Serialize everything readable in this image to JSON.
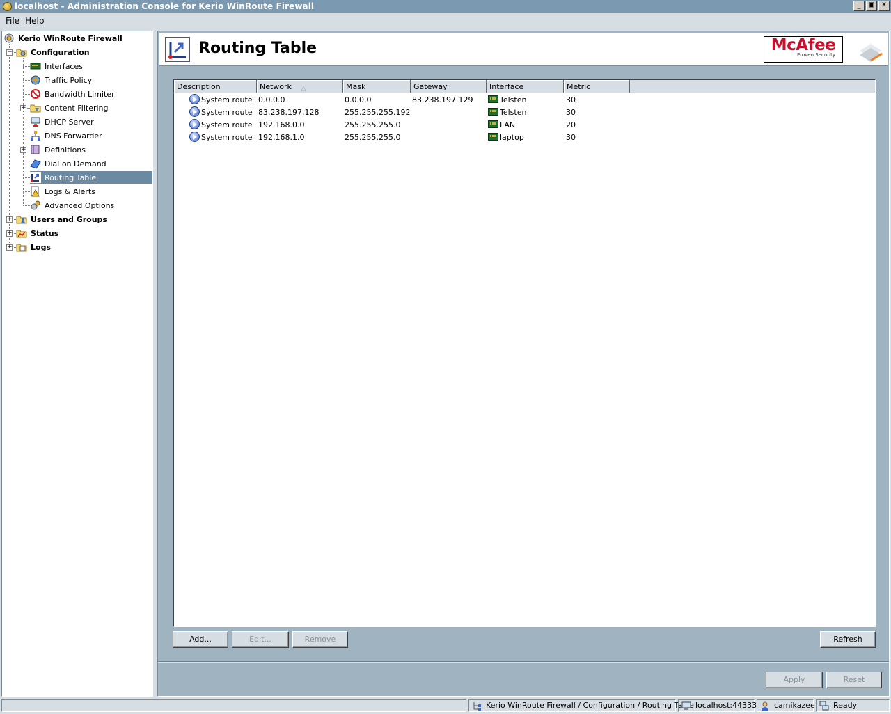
{
  "window": {
    "title": "localhost - Administration Console for Kerio WinRoute Firewall",
    "controls": [
      "_",
      "▣",
      "✕"
    ]
  },
  "menu": [
    "File",
    "Help"
  ],
  "tree": {
    "root": "Kerio WinRoute Firewall",
    "configuration": "Configuration",
    "items": [
      "Interfaces",
      "Traffic Policy",
      "Bandwidth Limiter",
      "Content Filtering",
      "DHCP Server",
      "DNS Forwarder",
      "Definitions",
      "Dial on Demand",
      "Routing Table",
      "Logs & Alerts",
      "Advanced Options"
    ],
    "groups": [
      "Users and Groups",
      "Status",
      "Logs"
    ]
  },
  "header": {
    "title": "Routing Table",
    "brand": "McAfee",
    "brand_tagline": "Proven Security"
  },
  "table": {
    "columns": [
      "Description",
      "Network",
      "Mask",
      "Gateway",
      "Interface",
      "Metric"
    ],
    "sort_indicator": "△",
    "rows": [
      {
        "description": "System route",
        "network": "0.0.0.0",
        "mask": "0.0.0.0",
        "gateway": "83.238.197.129",
        "interface": "Telsten",
        "metric": "30"
      },
      {
        "description": "System route",
        "network": "83.238.197.128",
        "mask": "255.255.255.192",
        "gateway": "",
        "interface": "Telsten",
        "metric": "30"
      },
      {
        "description": "System route",
        "network": "192.168.0.0",
        "mask": "255.255.255.0",
        "gateway": "",
        "interface": "LAN",
        "metric": "20"
      },
      {
        "description": "System route",
        "network": "192.168.1.0",
        "mask": "255.255.255.0",
        "gateway": "",
        "interface": "laptop",
        "metric": "30"
      }
    ]
  },
  "buttons": {
    "add": "Add...",
    "edit": "Edit...",
    "remove": "Remove",
    "refresh": "Refresh",
    "apply": "Apply",
    "reset": "Reset"
  },
  "status": {
    "path": "Kerio WinRoute Firewall / Configuration / Routing Table",
    "server": "localhost:44333",
    "user": "camikazee",
    "state": "Ready"
  }
}
